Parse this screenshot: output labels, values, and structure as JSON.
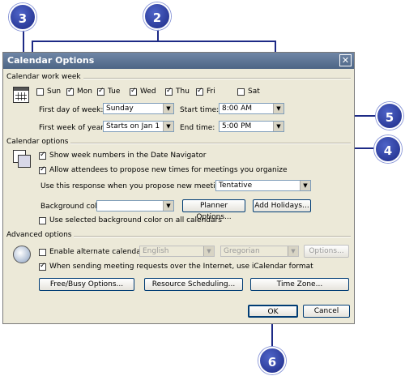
{
  "callouts": [
    "3",
    "2",
    "5",
    "4",
    "6"
  ],
  "dialog": {
    "title": "Calendar Options",
    "close_glyph": "✕",
    "work_week": {
      "label": "Calendar work week",
      "days": [
        {
          "label": "Sun",
          "checked": false
        },
        {
          "label": "Mon",
          "checked": true
        },
        {
          "label": "Tue",
          "checked": true
        },
        {
          "label": "Wed",
          "checked": true
        },
        {
          "label": "Thu",
          "checked": true
        },
        {
          "label": "Fri",
          "checked": true
        },
        {
          "label": "Sat",
          "checked": false
        }
      ],
      "first_day_label": "First day of week:",
      "first_day_value": "Sunday",
      "first_week_label": "First week of year:",
      "first_week_value": "Starts on Jan 1",
      "start_time_label": "Start time:",
      "start_time_value": "8:00 AM",
      "end_time_label": "End time:",
      "end_time_value": "5:00 PM"
    },
    "calendar_options": {
      "label": "Calendar options",
      "show_week_numbers": "Show week numbers in the Date Navigator",
      "allow_propose": "Allow attendees to propose new times for meetings you organize",
      "use_response_label": "Use this response when you propose new meeting times:",
      "use_response_value": "Tentative",
      "bg_color_label": "Background color:",
      "planner_options": "Planner Options...",
      "add_holidays": "Add Holidays...",
      "use_selected_bg": "Use selected background color on all calendars"
    },
    "advanced_options": {
      "label": "Advanced options",
      "enable_alt_calendar": "Enable alternate calendar:",
      "alt_lang": "English",
      "alt_type": "Gregorian",
      "options_button": "Options...",
      "icalendar": "When sending meeting requests over the Internet, use iCalendar format",
      "free_busy": "Free/Busy Options...",
      "resource_scheduling": "Resource Scheduling...",
      "time_zone": "Time Zone..."
    },
    "ok": "OK",
    "cancel": "Cancel"
  }
}
